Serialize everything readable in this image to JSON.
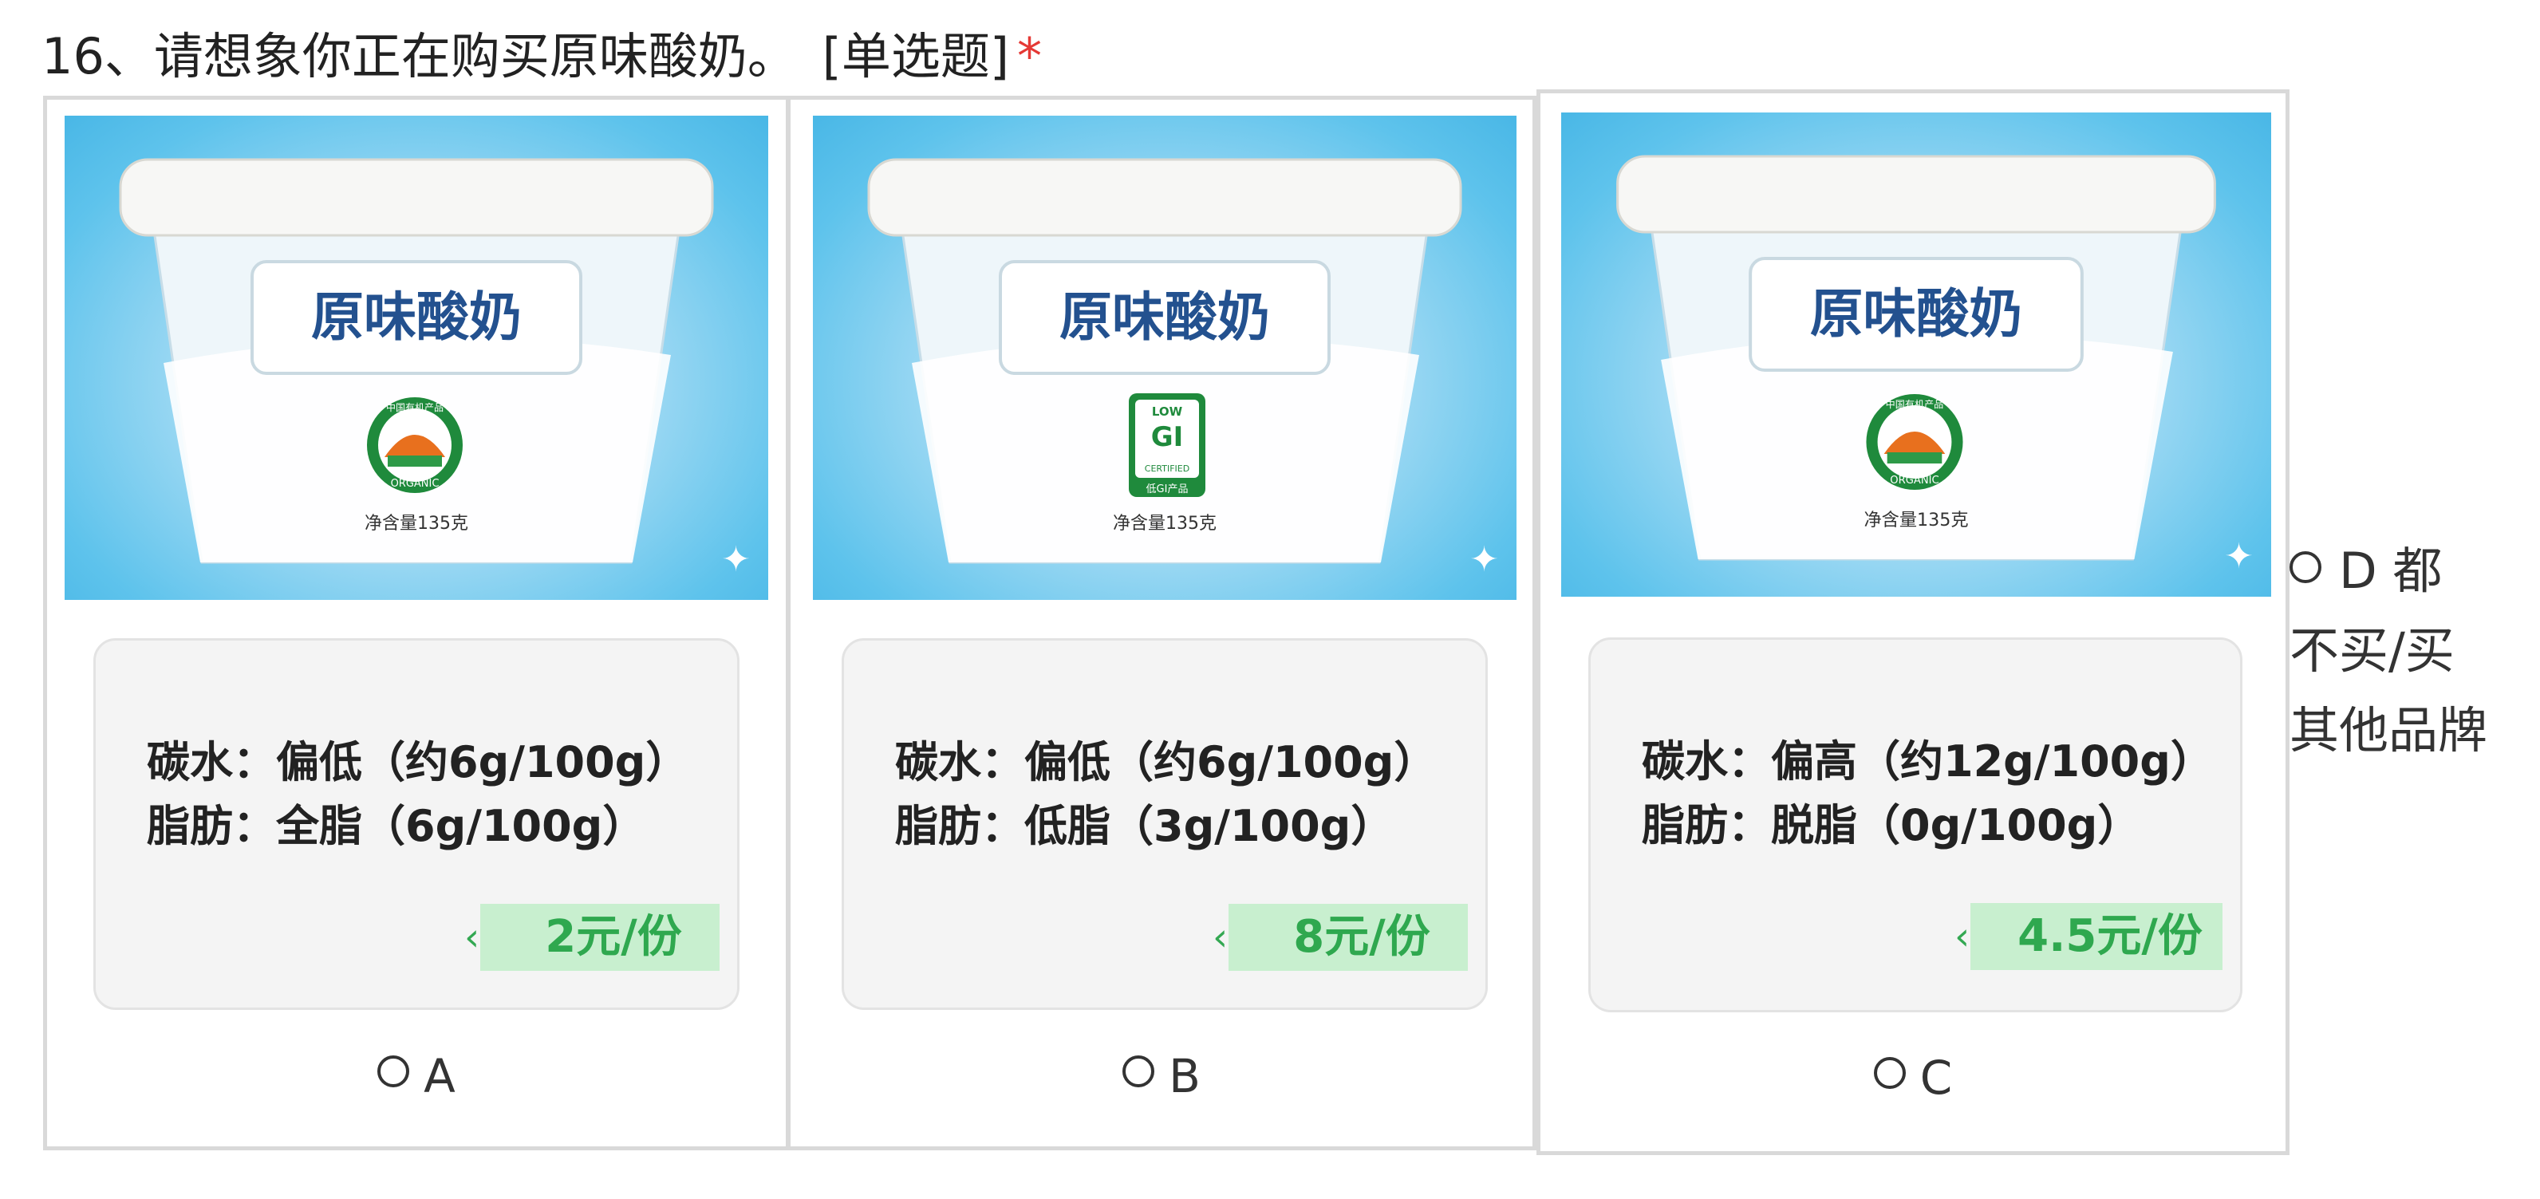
{
  "question": {
    "number": "16、",
    "text": "请想象你正在购买原味酸奶。",
    "type": "[单选题]",
    "required_mark": "*"
  },
  "colors": {
    "accent_green": "#2fa84f",
    "price_bg": "#c8efcf",
    "product_bg": "#5ec3ec",
    "required": "#e53935"
  },
  "options": [
    {
      "letter": "A",
      "product_name": "原味酸奶",
      "badge": "organic",
      "badge_top_text": "中国有机产品",
      "badge_bottom_text": "ORGANIC",
      "net_weight": "净含量135克",
      "carb": "碳水：偏低（约6g/100g）",
      "fat": "脂肪：全脂（6g/100g）",
      "price": "2元/份"
    },
    {
      "letter": "B",
      "product_name": "原味酸奶",
      "badge": "low-gi",
      "badge_top_text": "LOW",
      "badge_mid_text": "GI",
      "badge_bottom_text": "CERTIFIED",
      "badge_cn_text": "低GI产品",
      "net_weight": "净含量135克",
      "carb": "碳水：偏低（约6g/100g）",
      "fat": "脂肪：低脂（3g/100g）",
      "price": "8元/份"
    },
    {
      "letter": "C",
      "product_name": "原味酸奶",
      "badge": "organic",
      "badge_top_text": "中国有机产品",
      "badge_bottom_text": "ORGANIC",
      "net_weight": "净含量135克",
      "carb": "碳水：偏高（约12g/100g）",
      "fat": "脂肪：脱脂（0g/100g）",
      "price": "4.5元/份"
    }
  ],
  "option_d": {
    "letter": "D",
    "lines": [
      "都",
      "不买/买",
      "其他品牌"
    ]
  },
  "icons": {
    "price_chevron": "chevron-left-icon",
    "sparkle": "sparkle-icon",
    "radio": "radio-button-icon"
  }
}
